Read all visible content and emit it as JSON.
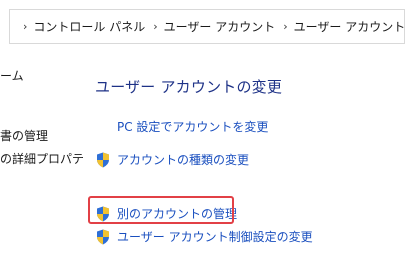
{
  "breadcrumb": {
    "items": [
      "コントロール パネル",
      "ユーザー アカウント",
      "ユーザー アカウント"
    ],
    "separator": "›"
  },
  "left_panel": {
    "items": [
      "ーム",
      "書の管理",
      "の詳細プロパテ"
    ]
  },
  "main": {
    "heading": "ユーザー アカウントの変更",
    "tasks": [
      {
        "label": "PC 設定でアカウントを変更",
        "icon": "none"
      },
      {
        "label": "アカウントの種類の変更",
        "icon": "uac-shield-icon"
      },
      {
        "label": "別のアカウントの管理",
        "icon": "uac-shield-icon",
        "highlighted": true
      },
      {
        "label": "ユーザー アカウント制御設定の変更",
        "icon": "uac-shield-icon"
      }
    ]
  },
  "colors": {
    "heading": "#1e3287",
    "link": "#1a4fbf",
    "highlight_border": "#e24046"
  }
}
